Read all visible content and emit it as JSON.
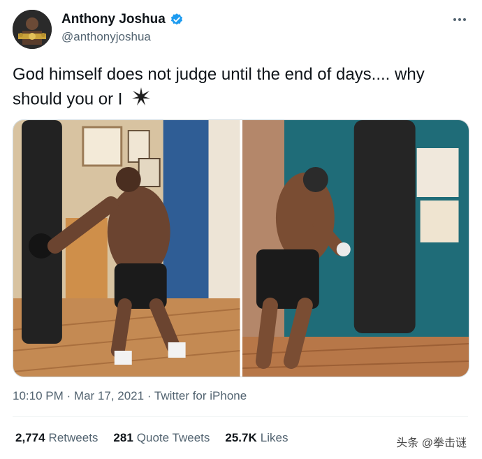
{
  "author": {
    "name": "Anthony Joshua",
    "handle": "@anthonyjoshua",
    "verified": true
  },
  "more_icon": "more-horizontal-icon",
  "tweet": {
    "text_line1": "God himself does not judge until the end of days.... why",
    "text_line2": "should you or I",
    "emoji": "sparkle-icon"
  },
  "media": {
    "photos": [
      {
        "subject": "boxer-training-heavy-bag-left"
      },
      {
        "subject": "boxer-training-heavy-bag-right"
      }
    ]
  },
  "meta": {
    "time": "10:10 PM",
    "sep1": "·",
    "date": "Mar 17, 2021",
    "sep2": "·",
    "source": "Twitter for iPhone"
  },
  "stats": {
    "retweets_count": "2,774",
    "retweets_label": "Retweets",
    "quotes_count": "281",
    "quotes_label": "Quote Tweets",
    "likes_count": "25.7K",
    "likes_label": "Likes"
  },
  "watermark": "头条 @拳击谜",
  "colors": {
    "verified_blue": "#1d9bf0",
    "text_primary": "#0f1419",
    "text_secondary": "#536471"
  }
}
